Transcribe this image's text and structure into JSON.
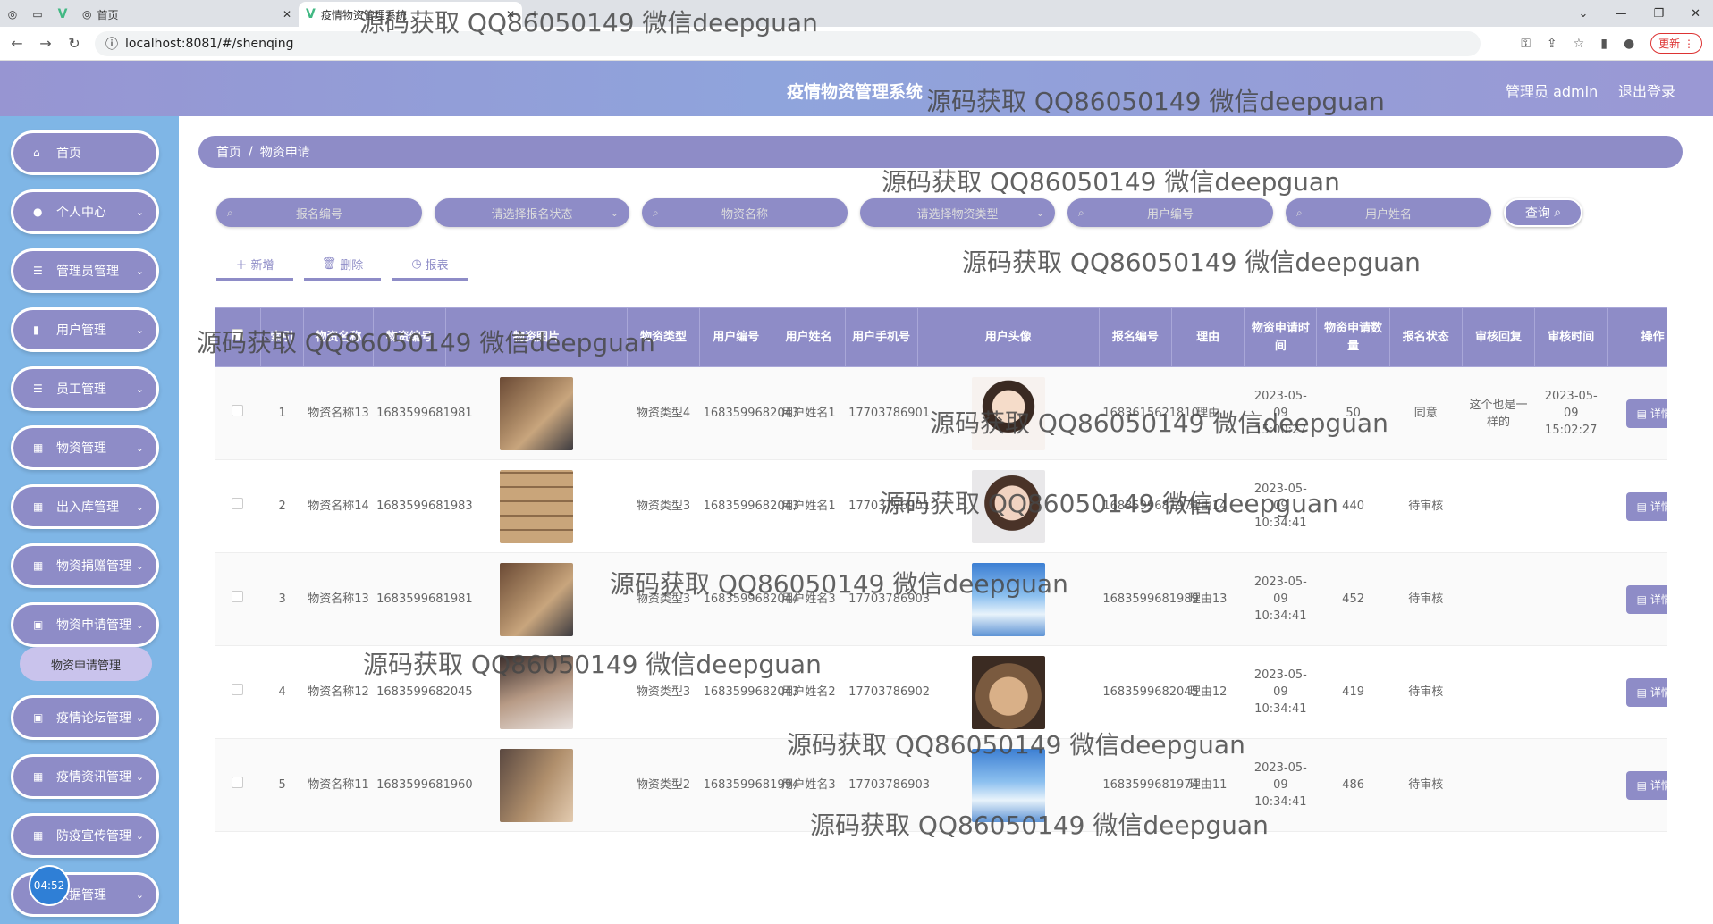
{
  "browser": {
    "tab1_label": "首页",
    "tab2_label": "疫情物资管理系统",
    "url": "localhost:8081/#/shenqing",
    "update_label": "更新"
  },
  "header": {
    "title": "疫情物资管理系统",
    "admin": "管理员 admin",
    "logout": "退出登录"
  },
  "sidebar": {
    "items": [
      {
        "label": "首页"
      },
      {
        "label": "个人中心"
      },
      {
        "label": "管理员管理"
      },
      {
        "label": "用户管理"
      },
      {
        "label": "员工管理"
      },
      {
        "label": "物资管理"
      },
      {
        "label": "出入库管理"
      },
      {
        "label": "物资捐赠管理"
      },
      {
        "label": "物资申请管理"
      },
      {
        "label": "疫情论坛管理"
      },
      {
        "label": "疫情资讯管理"
      },
      {
        "label": "防疫宣传管理"
      },
      {
        "label": "数据管理"
      }
    ],
    "submenu_label": "物资申请管理",
    "clock": "04:52"
  },
  "breadcrumb": {
    "home": "首页",
    "sep": "/",
    "current": "物资申请"
  },
  "filters": {
    "apply_no": "报名编号",
    "apply_status": "请选择报名状态",
    "goods_name": "物资名称",
    "goods_type": "请选择物资类型",
    "user_no": "用户编号",
    "user_name": "用户姓名",
    "query": "查询"
  },
  "actions": {
    "add": "新增",
    "delete": "删除",
    "report": "报表"
  },
  "table": {
    "headers": [
      "索引",
      "物资名称",
      "物资编号",
      "物资图片",
      "物资类型",
      "用户编号",
      "用户姓名",
      "用户手机号",
      "用户头像",
      "报名编号",
      "理由",
      "物资申请时间",
      "物资申请数量",
      "报名状态",
      "审核回复",
      "审核时间",
      "操作"
    ],
    "detail_label": "详情",
    "rows": [
      {
        "idx": "1",
        "name": "物资名称13",
        "no": "1683599681981",
        "type": "物资类型4",
        "uno": "1683599682043",
        "uname": "用户姓名1",
        "phone": "17703786901",
        "apply_no": "1683615621810",
        "reason": "理由",
        "time": "2023-05-09 15:00:27",
        "qty": "50",
        "status": "同意",
        "reply": "这个也是一样的",
        "audit_time": "2023-05-09 15:02:27",
        "goods_img": "goods1",
        "avatar": "face1"
      },
      {
        "idx": "2",
        "name": "物资名称14",
        "no": "1683599681983",
        "type": "物资类型3",
        "uno": "1683599682043",
        "uname": "用户姓名1",
        "phone": "17703786901",
        "apply_no": "1683599681974",
        "reason": "理由14",
        "time": "2023-05-09 10:34:41",
        "qty": "440",
        "status": "待审核",
        "reply": "",
        "audit_time": "",
        "goods_img": "goods2",
        "avatar": "face2"
      },
      {
        "idx": "3",
        "name": "物资名称13",
        "no": "1683599681981",
        "type": "物资类型3",
        "uno": "1683599682044",
        "uname": "用户姓名3",
        "phone": "17703786903",
        "apply_no": "1683599681989",
        "reason": "理由13",
        "time": "2023-05-09 10:34:41",
        "qty": "452",
        "status": "待审核",
        "reply": "",
        "audit_time": "",
        "goods_img": "goods1",
        "avatar": "boy"
      },
      {
        "idx": "4",
        "name": "物资名称12",
        "no": "1683599682045",
        "type": "物资类型3",
        "uno": "1683599682043",
        "uname": "用户姓名2",
        "phone": "17703786902",
        "apply_no": "1683599682045",
        "reason": "理由12",
        "time": "2023-05-09 10:34:41",
        "qty": "419",
        "status": "待审核",
        "reply": "",
        "audit_time": "",
        "goods_img": "goods3",
        "avatar": "cat"
      },
      {
        "idx": "5",
        "name": "物资名称11",
        "no": "1683599681960",
        "type": "物资类型2",
        "uno": "1683599681994",
        "uname": "用户姓名3",
        "phone": "17703786903",
        "apply_no": "1683599681974",
        "reason": "理由11",
        "time": "2023-05-09 10:34:41",
        "qty": "486",
        "status": "待审核",
        "reply": "",
        "audit_time": "",
        "goods_img": "goods4",
        "avatar": "boy"
      }
    ]
  },
  "watermark": "源码获取 QQ86050149 微信deepguan"
}
